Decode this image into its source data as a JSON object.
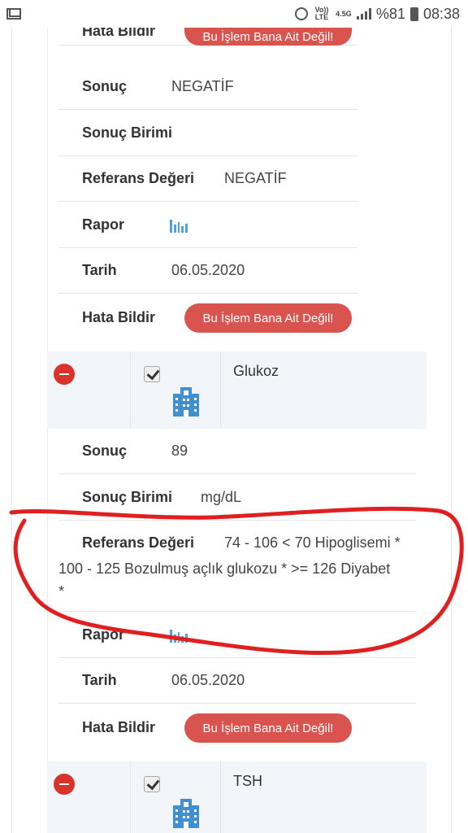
{
  "status": {
    "network": "Vo)) LTE",
    "speed": "4.5G",
    "battery": "%81",
    "time": "08:38"
  },
  "labels": {
    "hata_bildir": "Hata Bildir",
    "sonuc": "Sonuç",
    "sonuc_birimi": "Sonuç Birimi",
    "referans_degeri": "Referans Değeri",
    "rapor": "Rapor",
    "tarih": "Tarih",
    "error_button": "Bu İşlem Bana Ait Değil!"
  },
  "first_test": {
    "sonuc": "NEGATİF",
    "sonuc_birimi": "",
    "referans": "NEGATİF",
    "tarih": "06.05.2020"
  },
  "glukoz": {
    "name": "Glukoz",
    "sonuc": "89",
    "sonuc_birimi": "mg/dL",
    "referans_line1": "74 - 106 < 70 Hipoglisemi *",
    "referans_line2": "100 - 125 Bozulmuş açlık glukozu * >= 126 Diyabet",
    "referans_line3": "*",
    "tarih": "06.05.2020"
  },
  "tsh": {
    "name": "TSH"
  },
  "colors": {
    "error_button": "#d9534f",
    "minus_button": "#d9342b",
    "chart_icon": "#4aa3df",
    "building_icon": "#3f8fd1",
    "annotation": "#e02020"
  }
}
